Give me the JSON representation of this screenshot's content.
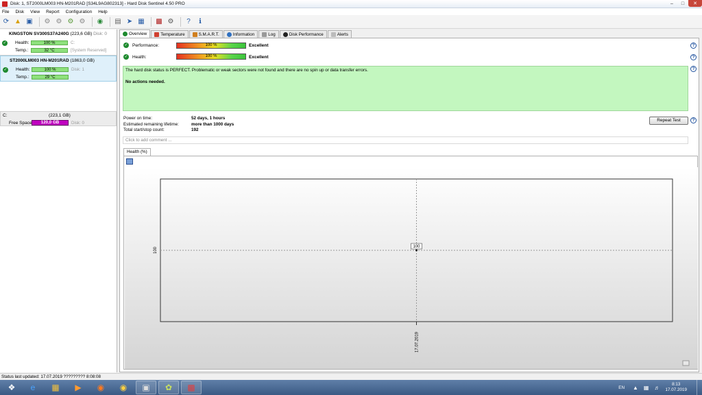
{
  "window": {
    "title": "Disk: 1, ST2000LM003 HN-M201RAD [S34L9AG802313] - Hard Disk Sentinel 4.50 PRO"
  },
  "menu": [
    "File",
    "Disk",
    "View",
    "Report",
    "Configuration",
    "Help"
  ],
  "disks": [
    {
      "name": "KINGSTON SV300S37A240G",
      "size": "(223,6 GB)",
      "disk_no": "Disk: 0",
      "health_label": "Health:",
      "health_value": "100 %",
      "temp_label": "Temp.:",
      "temp_value": "32 °C",
      "volume_note": "C:",
      "extra_note": "[System Reserved]",
      "health_fraction": 1.0
    },
    {
      "name": "ST2000LM003 HN-M201RAD",
      "size": "(1863,0 GB)",
      "health_label": "Health:",
      "health_value": "100 %",
      "temp_label": "Temp.:",
      "temp_value": "29 °C",
      "volume_note": "Disk: 1",
      "health_fraction": 1.0
    }
  ],
  "volume": {
    "name": "C:",
    "size": "(223,1 GB)",
    "free_label": "Free Space",
    "free_value": "120,0 GB",
    "disk": "Disk: 0"
  },
  "tabs": [
    "Overview",
    "Temperature",
    "S.M.A.R.T.",
    "Information",
    "Log",
    "Disk Performance",
    "Alerts"
  ],
  "overview": {
    "performance_label": "Performance:",
    "performance_value": "100 %",
    "performance_rating": "Excellent",
    "health_label": "Health:",
    "health_value": "100 %",
    "health_rating": "Excellent",
    "status_text": "The hard disk status is PERFECT. Problematic or weak sectors were not found and there are no spin up or data transfer errors.",
    "actions_text": "No actions needed.",
    "power_on_label": "Power on time:",
    "power_on_value": "52 days, 1 hours",
    "lifetime_label": "Estimated remaining lifetime:",
    "lifetime_value": "more than 1000 days",
    "startstop_label": "Total start/stop count:",
    "startstop_value": "192",
    "repeat_button": "Repeat Test",
    "comment_placeholder": "Click to add comment ..."
  },
  "chart_tab": "Health (%)",
  "chart_data": {
    "type": "line",
    "x": [
      "17.07.2019"
    ],
    "series": [
      {
        "values": [
          100
        ]
      }
    ],
    "xlabel": "",
    "ylabel": "",
    "y_tick_labels": [
      "100"
    ],
    "x_tick_labels": [
      "17.07.2019"
    ],
    "data_labels": [
      "100"
    ],
    "grid": true
  },
  "statusbar": {
    "text": "Status last updated: 17.07.2019 ????????? 8:08:08"
  },
  "taskbar": {
    "lang": "EN",
    "time": "8:13",
    "date": "17.07.2019"
  },
  "colors": {
    "status_bg": "#c3f7bf",
    "bar_green": "#8ee07c",
    "free_space": "#c000c0"
  }
}
